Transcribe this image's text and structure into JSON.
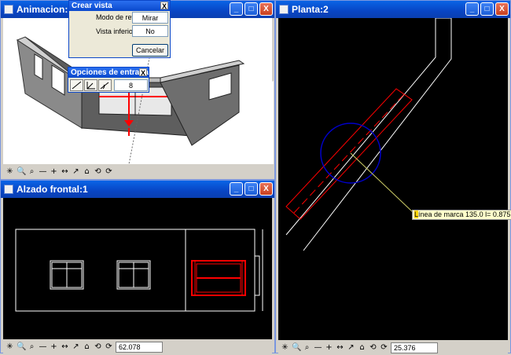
{
  "windows": {
    "anim": {
      "title": "Animacion: Modelo"
    },
    "alzado": {
      "title": "Alzado frontal:1"
    },
    "planta": {
      "title": "Planta:2"
    }
  },
  "titlebar_buttons": {
    "minimize": "_",
    "maximize": "□",
    "close": "X"
  },
  "crear_vista": {
    "title": "Crear vista",
    "close": "X",
    "modo_label": "Modo de ref.",
    "modo_value": "Mirar",
    "vista_label": "Vista inferior",
    "vista_value": "No",
    "cancel": "Cancelar"
  },
  "opciones_entrada": {
    "title": "Opciones de entrada",
    "close": "X",
    "value": "8"
  },
  "alzado_zoom": "62.078",
  "planta_zoom": "25.376",
  "tooltip": {
    "prefix": "L",
    "text": "ínea de marca 135.0  l=  0.875"
  },
  "toolbar_icons": [
    "✳",
    "🔍",
    "⌕",
    "—",
    "+",
    "↔",
    "↗",
    "⌂",
    "⟲",
    "⟳"
  ],
  "colors": {
    "selection_red": "#ff0000",
    "crosshair_blue": "#0000cc",
    "titlebar": "#0a5ae0"
  }
}
